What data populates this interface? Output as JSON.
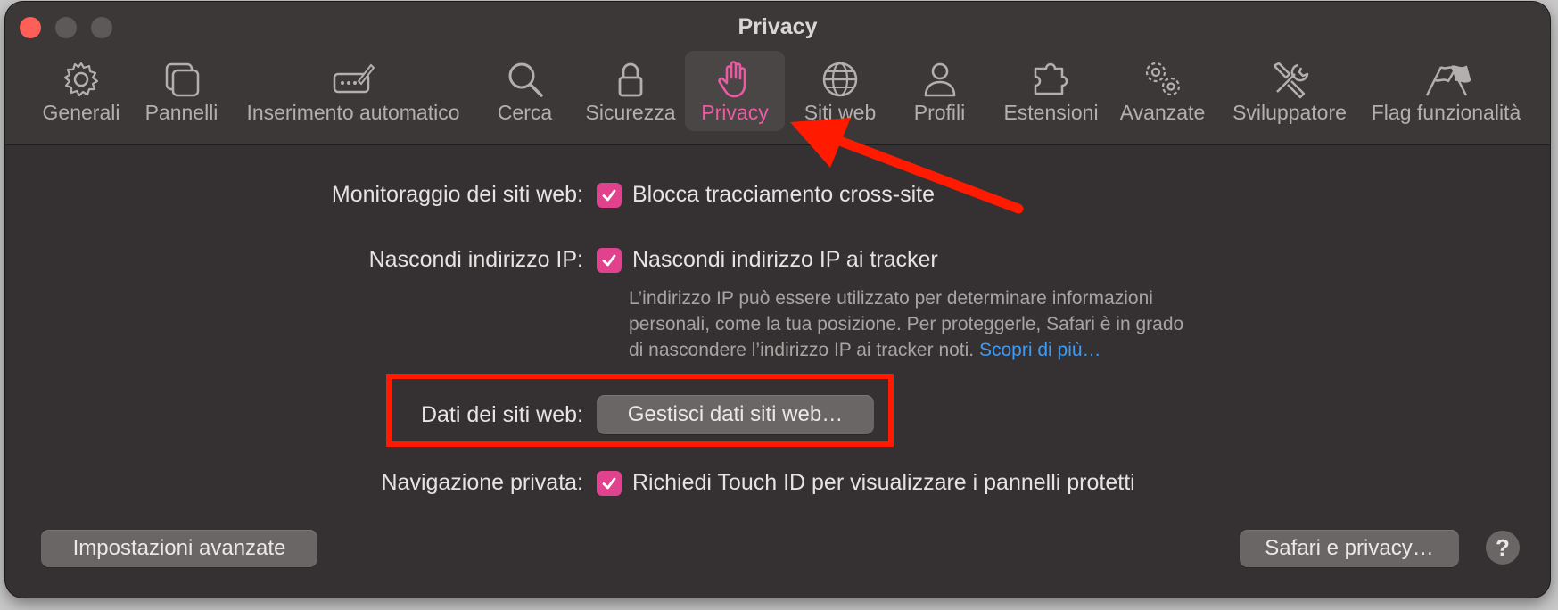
{
  "window": {
    "title": "Privacy"
  },
  "toolbar": {
    "tabs": [
      {
        "label": "Generali",
        "icon": "gear-icon"
      },
      {
        "label": "Pannelli",
        "icon": "tabs-icon"
      },
      {
        "label": "Inserimento automatico",
        "icon": "autofill-pen-icon"
      },
      {
        "label": "Cerca",
        "icon": "magnifier-icon"
      },
      {
        "label": "Sicurezza",
        "icon": "lock-icon"
      },
      {
        "label": "Privacy",
        "icon": "hand-icon",
        "selected": true
      },
      {
        "label": "Siti web",
        "icon": "globe-icon"
      },
      {
        "label": "Profili",
        "icon": "person-icon"
      },
      {
        "label": "Estensioni",
        "icon": "puzzle-icon"
      },
      {
        "label": "Avanzate",
        "icon": "gears-icon"
      },
      {
        "label": "Sviluppatore",
        "icon": "tools-icon"
      },
      {
        "label": "Flag funzionalità",
        "icon": "flags-icon"
      }
    ]
  },
  "settings": {
    "tracking_label": "Monitoraggio dei siti web:",
    "tracking_option": "Blocca tracciamento cross-site",
    "tracking_checked": true,
    "hide_ip_label": "Nascondi indirizzo IP:",
    "hide_ip_option": "Nascondi indirizzo IP ai tracker",
    "hide_ip_checked": true,
    "hide_ip_help_line1": "L’indirizzo IP può essere utilizzato per determinare informazioni",
    "hide_ip_help_line2": "personali, come la tua posizione. Per proteggerle, Safari è in grado",
    "hide_ip_help_line3": "di nascondere l’indirizzo IP ai tracker noti.",
    "hide_ip_help_link": "Scopri di più…",
    "website_data_label": "Dati dei siti web:",
    "website_data_button": "Gestisci dati siti web…",
    "private_label": "Navigazione privata:",
    "private_option": "Richiedi Touch ID per visualizzare i pannelli protetti",
    "private_checked": true
  },
  "footer": {
    "advanced_button": "Impostazioni avanzate",
    "safari_privacy_button": "Safari e privacy…",
    "help_button": "?"
  },
  "colors": {
    "accent": "#ec5aa6",
    "checkbox": "#e0428e",
    "link": "#3c9bf5",
    "annotation": "#ff1a00"
  }
}
